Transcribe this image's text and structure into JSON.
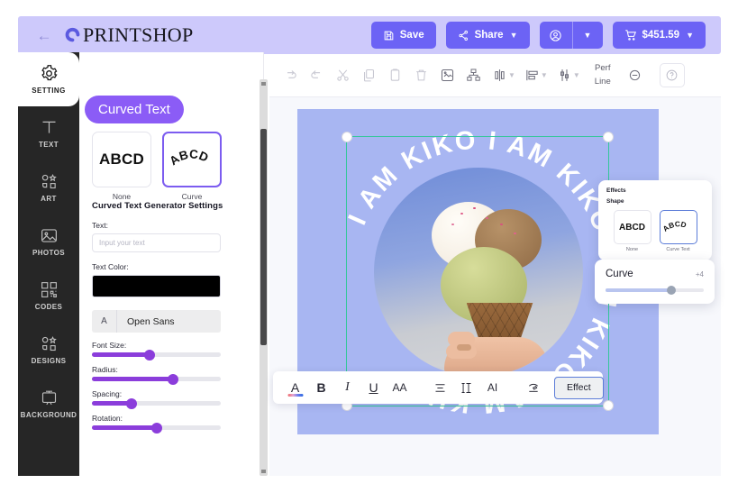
{
  "header": {
    "back_icon": "back-arrow-icon",
    "brand": "PRINTSHOP",
    "save_label": "Save",
    "share_label": "Share",
    "cart_label": "$451.59"
  },
  "rail": {
    "items": [
      {
        "label": "SETTING",
        "icon": "gear-icon",
        "active": true
      },
      {
        "label": "TEXT",
        "icon": "text-t-icon",
        "active": false
      },
      {
        "label": "ART",
        "icon": "shapes-icon",
        "active": false
      },
      {
        "label": "PHOTOS",
        "icon": "image-icon",
        "active": false
      },
      {
        "label": "CODES",
        "icon": "qr-code-icon",
        "active": false
      },
      {
        "label": "DESIGNS",
        "icon": "shapes-icon",
        "active": false
      },
      {
        "label": "BACKGROUND",
        "icon": "backdrop-icon",
        "active": false
      }
    ]
  },
  "panel": {
    "badge": "Curved Text",
    "shape_options": [
      {
        "label": "None",
        "sample": "ABCD",
        "selected": false
      },
      {
        "label": "Curve",
        "sample": "ABCD",
        "selected": true
      }
    ],
    "form_title": "Curved Text Generator Settings",
    "text_label": "Text:",
    "text_value": "",
    "text_placeholder": "Input your text",
    "color_label": "Text Color:",
    "color_value": "#000000",
    "font_badge": "A",
    "font_name": "Open Sans",
    "sliders": [
      {
        "label": "Font Size:",
        "percent": 45
      },
      {
        "label": "Radius:",
        "percent": 63
      },
      {
        "label": "Spacing:",
        "percent": 31
      },
      {
        "label": "Rotation:",
        "percent": 50
      }
    ]
  },
  "toolbar": {
    "items": [
      {
        "name": "redo-icon",
        "chevron": false
      },
      {
        "name": "undo-icon",
        "chevron": false
      },
      {
        "name": "cut-icon",
        "chevron": false
      },
      {
        "name": "copy-icon",
        "chevron": false
      },
      {
        "name": "paste-icon",
        "chevron": false
      },
      {
        "name": "delete-icon",
        "chevron": false
      },
      {
        "name": "crop-image-icon",
        "chevron": false
      },
      {
        "name": "group-icon",
        "chevron": false
      },
      {
        "name": "flip-horizontal-icon",
        "chevron": true
      },
      {
        "name": "align-icon",
        "chevron": true
      },
      {
        "name": "distribute-icon",
        "chevron": true
      }
    ],
    "perf_line": "Perf\nLine",
    "perf_line_1": "Perf",
    "perf_line_2": "Line",
    "help_label": "?"
  },
  "canvas": {
    "curved_text": "I AM KIKO ",
    "artwork": "ice-cream-cone-photo"
  },
  "effects_popup": {
    "title": "Effects",
    "subtitle": "Shape",
    "options": [
      {
        "label": "None",
        "sample": "ABCD",
        "selected": false
      },
      {
        "label": "Curve Text",
        "sample": "ABCD",
        "selected": true
      }
    ],
    "curve_label": "Curve",
    "curve_value": "+4",
    "curve_percent": 67
  },
  "text_toolbar": {
    "buttons": [
      {
        "name": "text-color-icon",
        "label": "A"
      },
      {
        "name": "bold-icon",
        "label": "B"
      },
      {
        "name": "italic-icon",
        "label": "I"
      },
      {
        "name": "underline-icon",
        "label": "U"
      },
      {
        "name": "letter-case-icon",
        "label": "AA"
      },
      {
        "name": "align-text-icon",
        "label": "≡"
      },
      {
        "name": "line-height-icon",
        "label": "I̵T"
      },
      {
        "name": "ai-icon",
        "label": "AI"
      },
      {
        "name": "curve-tool-icon",
        "label": "☂"
      }
    ],
    "effect_label": "Effect"
  },
  "colors": {
    "header_bg": "#cdc9fb",
    "accent": "#6c63f5",
    "badge_purple": "#8b5cf6",
    "slider_purple": "#8b3ddb",
    "rail_bg": "#262626",
    "artboard_bg": "#a8b6f2",
    "selection_green": "#34c79a"
  }
}
